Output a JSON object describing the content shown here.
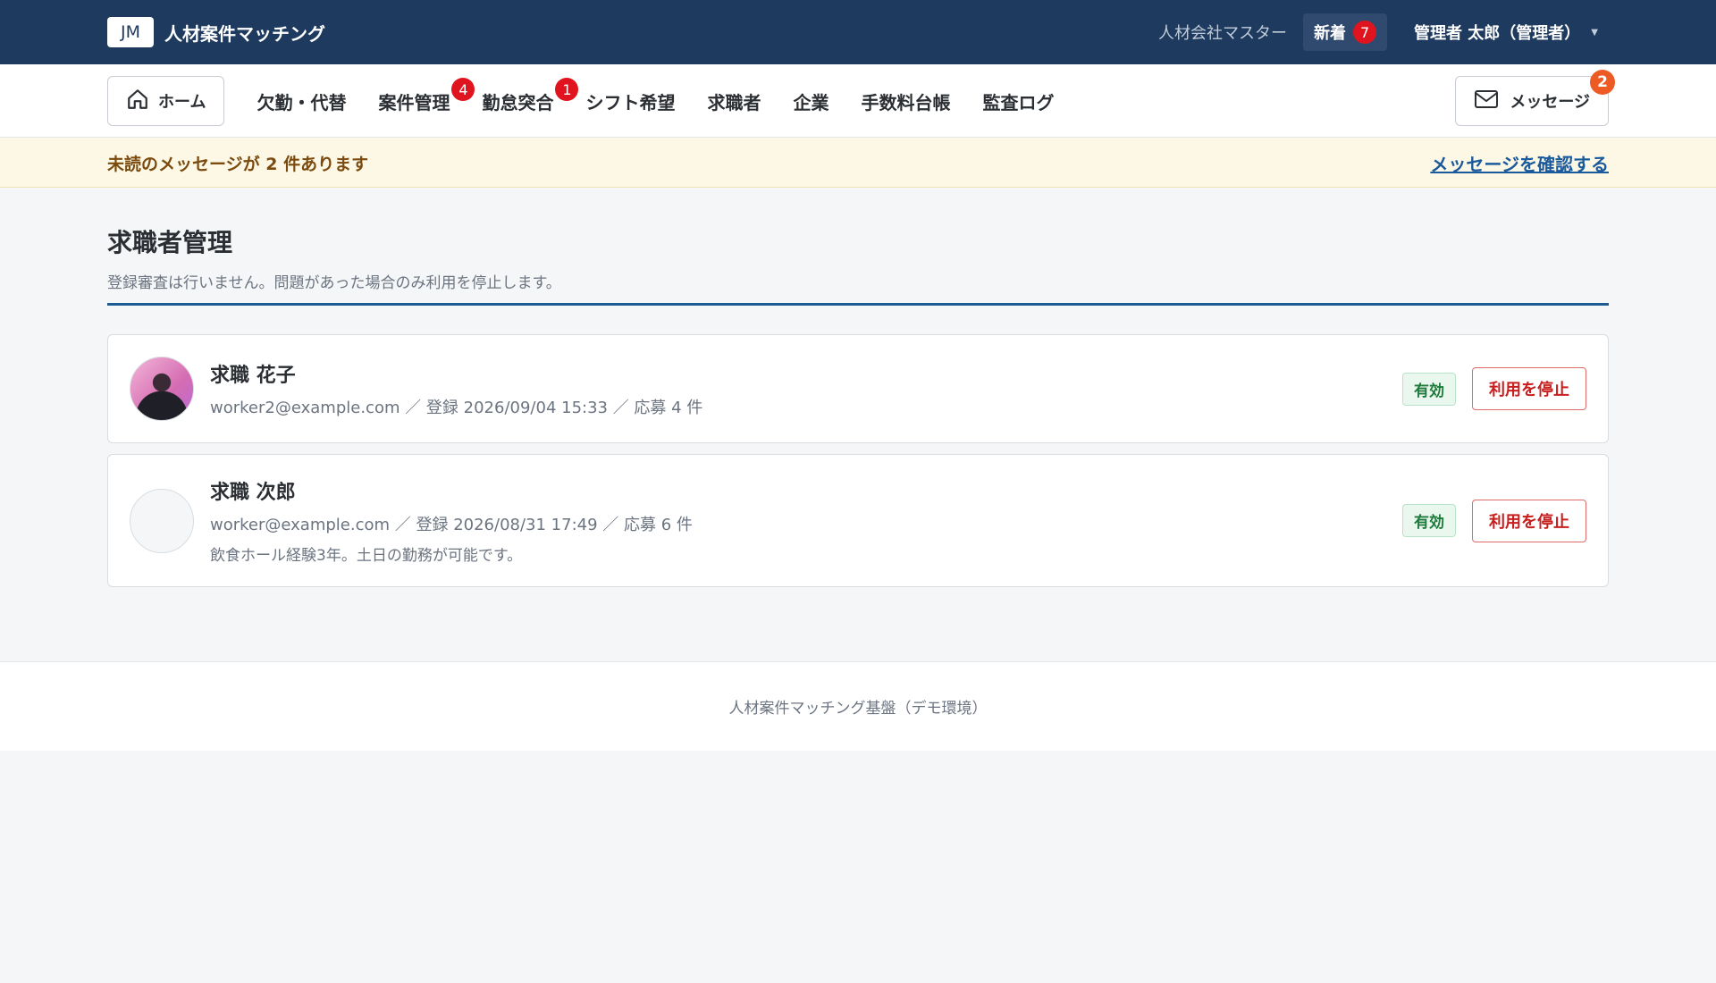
{
  "header": {
    "logo": "JM",
    "title": "人材案件マッチング",
    "company": "人材会社マスター",
    "new_label": "新着",
    "new_count": "7",
    "user": "管理者 太郎（管理者）"
  },
  "nav": {
    "home": "ホーム",
    "items": [
      {
        "label": "欠勤・代替",
        "badge": ""
      },
      {
        "label": "案件管理",
        "badge": "4"
      },
      {
        "label": "勤怠突合",
        "badge": "1"
      },
      {
        "label": "シフト希望",
        "badge": ""
      },
      {
        "label": "求職者",
        "badge": ""
      },
      {
        "label": "企業",
        "badge": ""
      },
      {
        "label": "手数料台帳",
        "badge": ""
      },
      {
        "label": "監査ログ",
        "badge": ""
      }
    ],
    "message_label": "メッセージ",
    "message_count": "2"
  },
  "notice": {
    "text": "未読のメッセージが 2 件あります",
    "link": "メッセージを確認する"
  },
  "page": {
    "title": "求職者管理",
    "description": "登録審査は行いません。問題があった場合のみ利用を停止します。"
  },
  "workers": [
    {
      "name": "求職 花子",
      "meta": "worker2@example.com ／ 登録 2026/09/04 15:33 ／ 応募 4 件",
      "note": "",
      "status": "有効",
      "action": "利用を停止"
    },
    {
      "name": "求職 次郎",
      "meta": "worker@example.com ／ 登録 2026/08/31 17:49 ／ 応募 6 件",
      "note": "飲食ホール経験3年。土日の勤務が可能です。",
      "status": "有効",
      "action": "利用を停止"
    }
  ],
  "footer": {
    "text": "人材案件マッチング基盤（デモ環境）"
  }
}
